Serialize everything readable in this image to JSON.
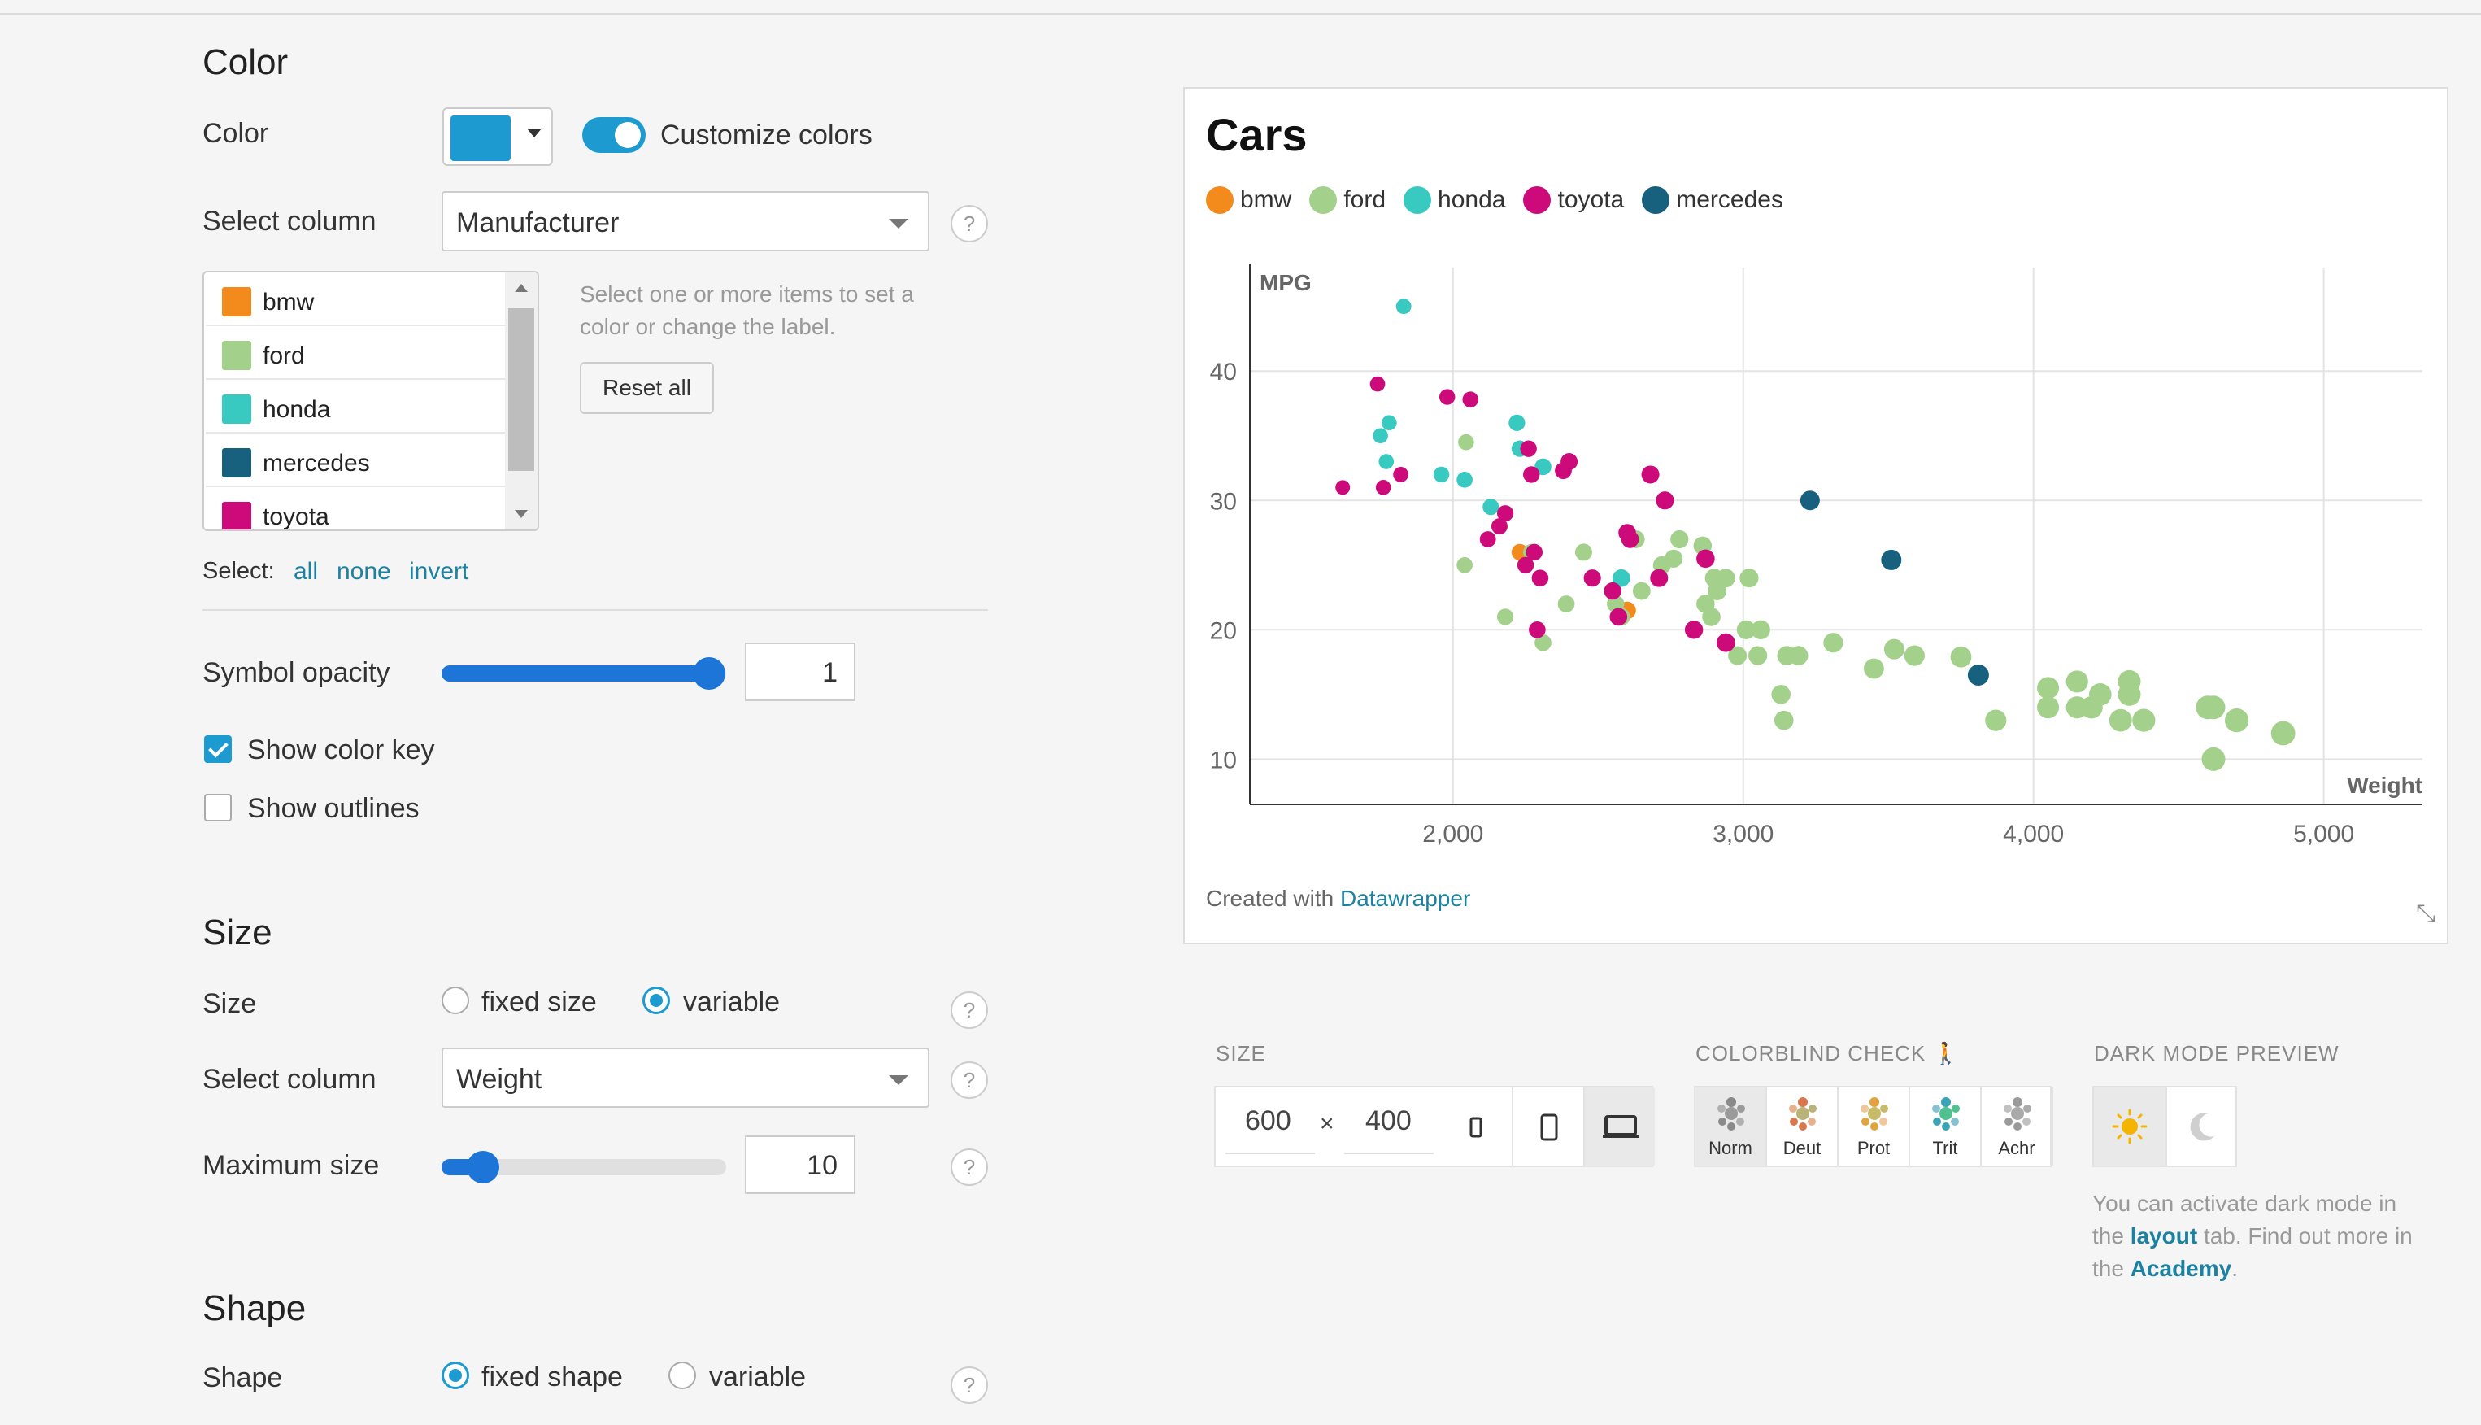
{
  "color_section": {
    "heading": "Color",
    "color_label": "Color",
    "customize_label": "Customize colors",
    "select_column_label": "Select column",
    "select_column_value": "Manufacturer",
    "items": [
      {
        "label": "bmw",
        "color": "#f28a1c"
      },
      {
        "label": "ford",
        "color": "#a3d18c"
      },
      {
        "label": "honda",
        "color": "#38c9c0"
      },
      {
        "label": "mercedes",
        "color": "#17607e"
      },
      {
        "label": "toyota",
        "color": "#cc0a7a"
      }
    ],
    "hint": "Select one or more items to set a color or change the label.",
    "reset_label": "Reset all",
    "select_prefix": "Select:",
    "select_all": "all",
    "select_none": "none",
    "select_invert": "invert",
    "opacity_label": "Symbol opacity",
    "opacity_value": "1",
    "show_key_label": "Show color key",
    "show_outlines_label": "Show outlines",
    "accent": "#1d9bd1"
  },
  "size_section": {
    "heading": "Size",
    "size_label": "Size",
    "fixed_label": "fixed size",
    "variable_label": "variable",
    "select_column_label": "Select column",
    "select_column_value": "Weight",
    "max_label": "Maximum size",
    "max_value": "10"
  },
  "shape_section": {
    "heading": "Shape",
    "shape_label": "Shape",
    "fixed_label": "fixed shape",
    "variable_label": "variable"
  },
  "help_glyph": "?",
  "chart_data": {
    "type": "scatter",
    "title": "Cars",
    "xlabel": "Weight",
    "ylabel": "MPG",
    "xlim": [
      1300,
      5340
    ],
    "ylim": [
      6.5,
      48
    ],
    "xticks": [
      2000,
      3000,
      4000,
      5000
    ],
    "xtick_labels": [
      "2,000",
      "3,000",
      "4,000",
      "5,000"
    ],
    "yticks": [
      10,
      20,
      30,
      40
    ],
    "grid": true,
    "legend_order": [
      "bmw",
      "ford",
      "honda",
      "toyota",
      "mercedes"
    ],
    "colors": {
      "bmw": "#f28a1c",
      "ford": "#a3d18c",
      "honda": "#38c9c0",
      "toyota": "#cc0a7a",
      "mercedes": "#17607e"
    },
    "series": [
      {
        "name": "bmw",
        "points": [
          [
            2230,
            26
          ],
          [
            2600,
            21.5
          ]
        ]
      },
      {
        "name": "ford",
        "points": [
          [
            2045,
            34.5
          ],
          [
            2040,
            25
          ],
          [
            2180,
            21
          ],
          [
            2310,
            19
          ],
          [
            2270,
            26
          ],
          [
            2390,
            22
          ],
          [
            2450,
            26
          ],
          [
            2560,
            22
          ],
          [
            2580,
            21
          ],
          [
            2650,
            23
          ],
          [
            2630,
            27
          ],
          [
            2720,
            25
          ],
          [
            2760,
            25.5
          ],
          [
            2780,
            27
          ],
          [
            2860,
            26.5
          ],
          [
            2870,
            22
          ],
          [
            2890,
            21
          ],
          [
            2910,
            23
          ],
          [
            2900,
            24
          ],
          [
            2940,
            24
          ],
          [
            2980,
            18
          ],
          [
            3010,
            20
          ],
          [
            3020,
            24
          ],
          [
            3050,
            18
          ],
          [
            3060,
            20
          ],
          [
            3130,
            15
          ],
          [
            3140,
            13
          ],
          [
            3150,
            18
          ],
          [
            3190,
            18
          ],
          [
            3310,
            19
          ],
          [
            3450,
            17
          ],
          [
            3520,
            18.5
          ],
          [
            3590,
            18
          ],
          [
            3750,
            17.9
          ],
          [
            3870,
            13
          ],
          [
            4050,
            14
          ],
          [
            4050,
            15.5
          ],
          [
            4150,
            14
          ],
          [
            4150,
            16
          ],
          [
            4200,
            14
          ],
          [
            4230,
            15
          ],
          [
            4300,
            13
          ],
          [
            4330,
            15
          ],
          [
            4330,
            16
          ],
          [
            4380,
            13
          ],
          [
            4600,
            14
          ],
          [
            4620,
            14
          ],
          [
            4700,
            13
          ],
          [
            4860,
            12
          ],
          [
            4620,
            10
          ]
        ]
      },
      {
        "name": "honda",
        "points": [
          [
            1830,
            45
          ],
          [
            1780,
            36
          ],
          [
            1750,
            35
          ],
          [
            1770,
            33
          ],
          [
            1960,
            32
          ],
          [
            2040,
            31.6
          ],
          [
            2220,
            36
          ],
          [
            2230,
            34
          ],
          [
            2130,
            29.5
          ],
          [
            2310,
            32.6
          ],
          [
            2580,
            24
          ]
        ]
      },
      {
        "name": "toyota",
        "points": [
          [
            1620,
            31
          ],
          [
            1740,
            39
          ],
          [
            1760,
            31
          ],
          [
            1820,
            32
          ],
          [
            1980,
            38
          ],
          [
            2060,
            37.8
          ],
          [
            2120,
            27
          ],
          [
            2160,
            28
          ],
          [
            2180,
            29
          ],
          [
            2250,
            25
          ],
          [
            2260,
            34
          ],
          [
            2270,
            32
          ],
          [
            2280,
            26
          ],
          [
            2300,
            24
          ],
          [
            2290,
            20
          ],
          [
            2400,
            33
          ],
          [
            2380,
            32.3
          ],
          [
            2480,
            24
          ],
          [
            2550,
            23
          ],
          [
            2570,
            21
          ],
          [
            2600,
            27.5
          ],
          [
            2680,
            32
          ],
          [
            2710,
            24
          ],
          [
            2730,
            30
          ],
          [
            2610,
            27
          ],
          [
            2830,
            20
          ],
          [
            2870,
            25.5
          ],
          [
            2940,
            19
          ]
        ]
      },
      {
        "name": "mercedes",
        "points": [
          [
            3230,
            30
          ],
          [
            3510,
            25.4
          ],
          [
            3810,
            16.5
          ]
        ]
      }
    ]
  },
  "credit_prefix": "Created with",
  "credit_link": "Datawrapper",
  "toolbar": {
    "size_heading": "SIZE",
    "width": "600",
    "times": "×",
    "height": "400",
    "colorblind_heading": "COLORBLIND CHECK",
    "colorblind_modes": [
      "Norm",
      "Deut",
      "Prot",
      "Trit",
      "Achr"
    ],
    "colorblind_colors": [
      [
        "#8a8a8a",
        "#9a9a9a",
        "#b0b0b0"
      ],
      [
        "#d9784e",
        "#b9b37a",
        "#e6b08c"
      ],
      [
        "#e0a340",
        "#c7bb6a",
        "#f0c79a"
      ],
      [
        "#3ba3b8",
        "#4fc08f",
        "#87c0d0"
      ],
      [
        "#9a9a9a",
        "#aaaaaa",
        "#c0c0c0"
      ]
    ],
    "dark_heading": "DARK MODE PREVIEW",
    "dark_note_1": "You can activate dark mode in the ",
    "dark_note_link1": "layout",
    "dark_note_2": " tab. Find out more in the ",
    "dark_note_link2": "Academy",
    "dark_note_3": "."
  }
}
